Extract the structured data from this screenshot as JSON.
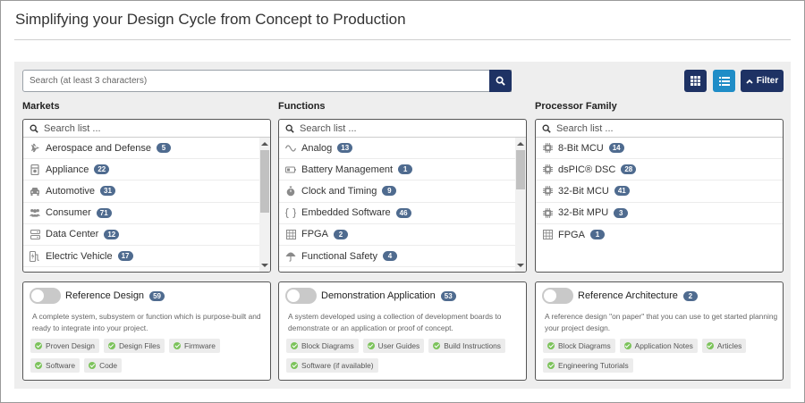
{
  "page_title": "Simplifying your Design Cycle from Concept to Production",
  "search": {
    "placeholder": "Search (at least 3 characters)"
  },
  "toolbar": {
    "filter_label": "Filter",
    "accent_dark": "#1e3264",
    "accent_light": "#1f8dc7"
  },
  "columns": [
    {
      "heading": "Markets",
      "search_placeholder": "Search list ...",
      "items": [
        {
          "label": "Aerospace and Defense",
          "count": "5",
          "icon": "plane-icon"
        },
        {
          "label": "Appliance",
          "count": "22",
          "icon": "appliance-icon"
        },
        {
          "label": "Automotive",
          "count": "31",
          "icon": "car-icon"
        },
        {
          "label": "Consumer",
          "count": "71",
          "icon": "people-icon"
        },
        {
          "label": "Data Center",
          "count": "12",
          "icon": "server-icon"
        },
        {
          "label": "Electric Vehicle",
          "count": "17",
          "icon": "ev-charger-icon"
        }
      ],
      "card": {
        "title": "Reference Design",
        "count": "59",
        "description": "A complete system, subsystem or function which is purpose-built and ready to integrate into your project.",
        "tags": [
          "Proven Design",
          "Design Files",
          "Firmware",
          "Software",
          "Code"
        ]
      }
    },
    {
      "heading": "Functions",
      "search_placeholder": "Search list ...",
      "items": [
        {
          "label": "Analog",
          "count": "13",
          "icon": "sine-wave-icon"
        },
        {
          "label": "Battery Management",
          "count": "1",
          "icon": "battery-icon"
        },
        {
          "label": "Clock and Timing",
          "count": "9",
          "icon": "stopwatch-icon"
        },
        {
          "label": "Embedded Software",
          "count": "46",
          "icon": "code-braces-icon"
        },
        {
          "label": "FPGA",
          "count": "2",
          "icon": "fpga-grid-icon"
        },
        {
          "label": "Functional Safety",
          "count": "4",
          "icon": "umbrella-icon"
        }
      ],
      "card": {
        "title": "Demonstration Application",
        "count": "53",
        "description": "A system developed using a collection of development boards to demonstrate or an application or proof of concept.",
        "tags": [
          "Block Diagrams",
          "User Guides",
          "Build Instructions",
          "Software (if available)"
        ]
      }
    },
    {
      "heading": "Processor Family",
      "search_placeholder": "Search list ...",
      "items": [
        {
          "label": "8-Bit MCU",
          "count": "14",
          "icon": "chip-icon"
        },
        {
          "label": "dsPIC® DSC",
          "count": "28",
          "icon": "chip-icon"
        },
        {
          "label": "32-Bit MCU",
          "count": "41",
          "icon": "chip-icon"
        },
        {
          "label": "32-Bit MPU",
          "count": "3",
          "icon": "chip-icon"
        },
        {
          "label": "FPGA",
          "count": "1",
          "icon": "fpga-grid-icon"
        }
      ],
      "card": {
        "title": "Reference Architecture",
        "count": "2",
        "description": "A reference design \"on paper\" that you can use to get started planning your project design.",
        "tags": [
          "Block Diagrams",
          "Application Notes",
          "Articles",
          "Engineering Tutorials"
        ]
      }
    }
  ]
}
